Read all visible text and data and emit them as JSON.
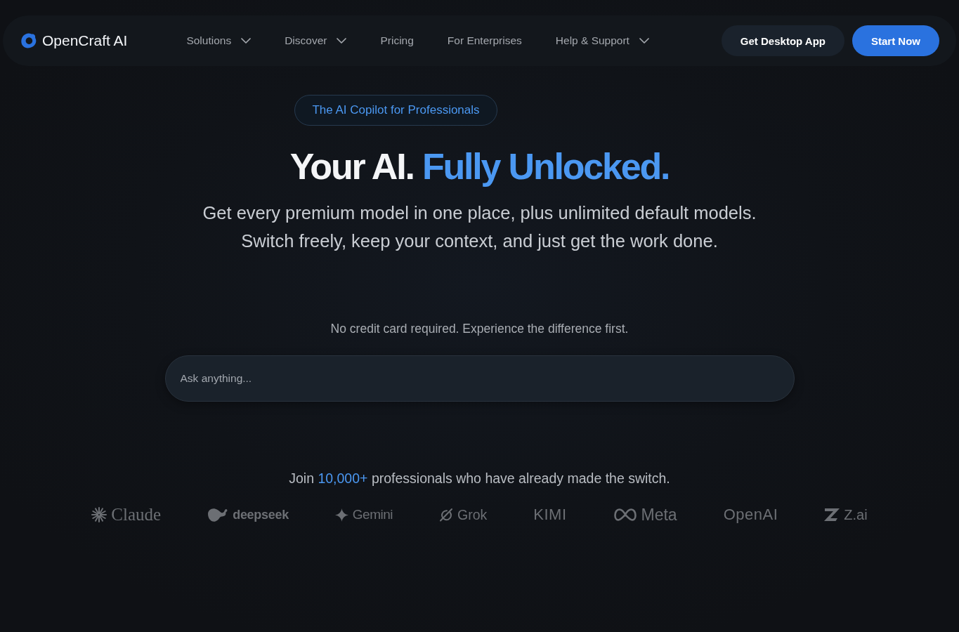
{
  "nav": {
    "brand": "OpenCraft AI",
    "links": [
      {
        "label": "Solutions",
        "menu": true
      },
      {
        "label": "Discover",
        "menu": true
      },
      {
        "label": "Pricing",
        "menu": false
      },
      {
        "label": "For Enterprises",
        "menu": false
      },
      {
        "label": "Help & Support",
        "menu": true
      }
    ],
    "buttons": [
      {
        "label": "Get Desktop App",
        "kind": "secondary"
      },
      {
        "label": "Start Now",
        "kind": "primary"
      }
    ]
  },
  "hero": {
    "badge": "The AI Copilot for Professionals",
    "headline": {
      "lead": "Your AI.",
      "highlight": "Fully Unlocked."
    },
    "subtitle": [
      "Get every premium model in one place, plus unlimited default models.",
      "Switch freely, keep your context, and just get the work done."
    ],
    "note": "No credit card required. Experience the difference first.",
    "prompt": {
      "placeholder": "Ask anything..."
    }
  },
  "social_proof": {
    "before": "Join",
    "highlight": "10,000+",
    "after": "professionals who have already made the switch."
  },
  "logos": [
    {
      "name": "Claude",
      "kind": "sunburst"
    },
    {
      "name": "deepseek",
      "kind": "whale"
    },
    {
      "name": "Gemini",
      "kind": "sparkle"
    },
    {
      "name": "Grok",
      "kind": "slashed-circle"
    },
    {
      "name": "KIMI",
      "kind": "wordmark"
    },
    {
      "name": "Meta",
      "kind": "infinity"
    },
    {
      "name": "OpenAI",
      "kind": "wordmark"
    },
    {
      "name": "Z.ai",
      "kind": "z-mark"
    }
  ]
}
